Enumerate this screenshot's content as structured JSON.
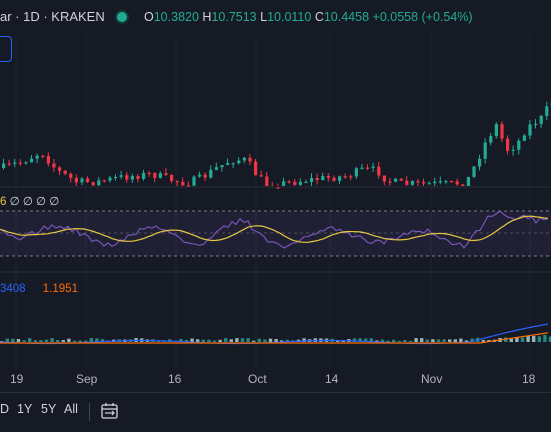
{
  "header": {
    "symbol": "ar · 1D · KRAKEN",
    "ohlc": [
      {
        "k": "O",
        "v": "10.3820"
      },
      {
        "k": "H",
        "v": "10.7513"
      },
      {
        "k": "L",
        "v": "10.0110"
      },
      {
        "k": "C",
        "v": "10.4458"
      }
    ],
    "change": "+0.0558 (+0.54%)"
  },
  "rsi": {
    "value": "6",
    "placeholders": "∅ ∅ ∅ ∅"
  },
  "macd": {
    "macd_value": "3408",
    "signal_value": "1.1951"
  },
  "xaxis": {
    "ticks": [
      "19",
      "Sep",
      "16",
      "Oct",
      "14",
      "Nov",
      "18"
    ]
  },
  "toolbar": {
    "ranges": [
      "D",
      "1Y",
      "5Y",
      "All"
    ],
    "calendar_icon": "calendar-range-icon"
  },
  "colors": {
    "up": "#22ab94",
    "down": "#f23645",
    "rsi_line": "#7e57c2",
    "rsi_ma": "#e8c840",
    "macd_line": "#2962ff",
    "signal_line": "#ff6d00",
    "background": "#161a25"
  }
}
